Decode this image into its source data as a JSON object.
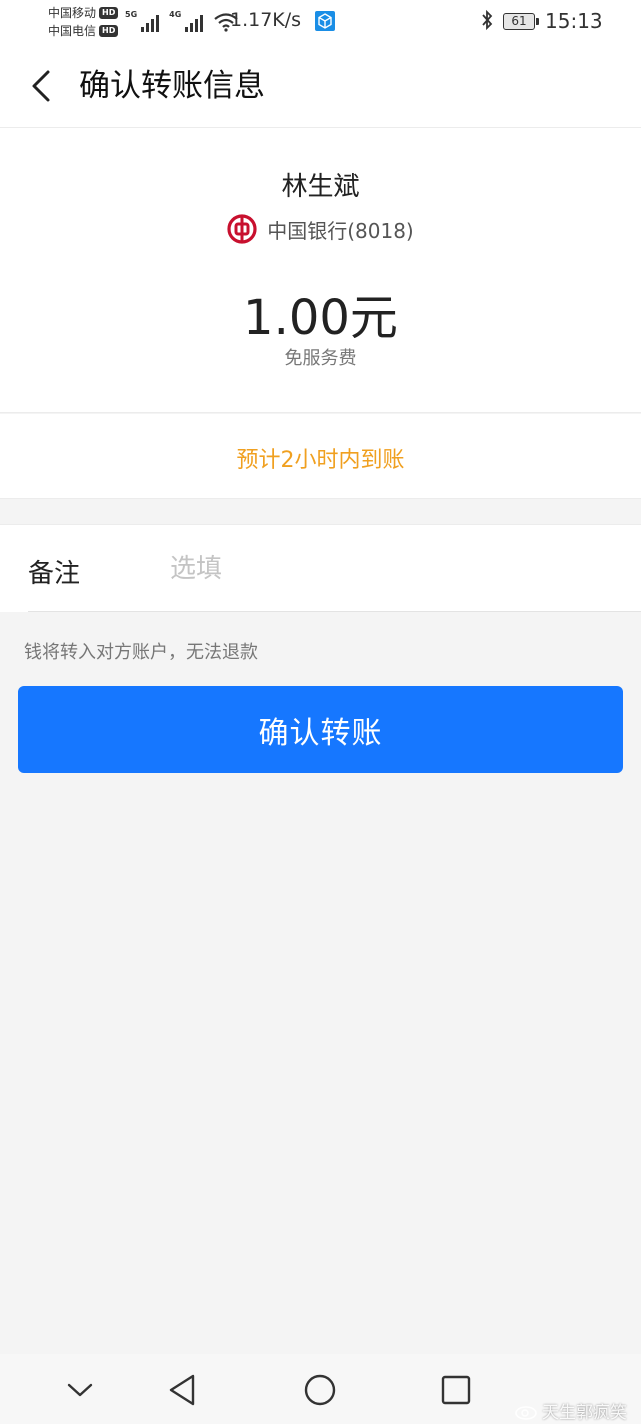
{
  "status_bar": {
    "carrier1": "中国移动",
    "carrier2": "中国电信",
    "hd": "HD",
    "net1": "5G",
    "net2": "4G",
    "speed": "1.17K/s",
    "battery": "61",
    "time": "15:13"
  },
  "header": {
    "title": "确认转账信息"
  },
  "payee": {
    "name": "林生斌",
    "bank": "中国银行(8018)",
    "amount": "1.00元",
    "fee_note": "免服务费"
  },
  "eta": {
    "text": "预计2小时内到账"
  },
  "remark": {
    "label": "备注",
    "placeholder": "选填",
    "value": ""
  },
  "warning": "钱将转入对方账户，无法退款",
  "confirm_button": "确认转账",
  "watermark": "天生郭疯笑",
  "colors": {
    "primary": "#1677ff",
    "eta": "#f0a020",
    "bank_red": "#c8102e",
    "background": "#f4f4f4"
  },
  "icons": {
    "back": "chevron-left-icon",
    "bank": "bank-of-china-logo",
    "nav_down": "chevron-down-icon",
    "nav_back": "triangle-back-icon",
    "nav_home": "circle-home-icon",
    "nav_recent": "square-recents-icon"
  }
}
